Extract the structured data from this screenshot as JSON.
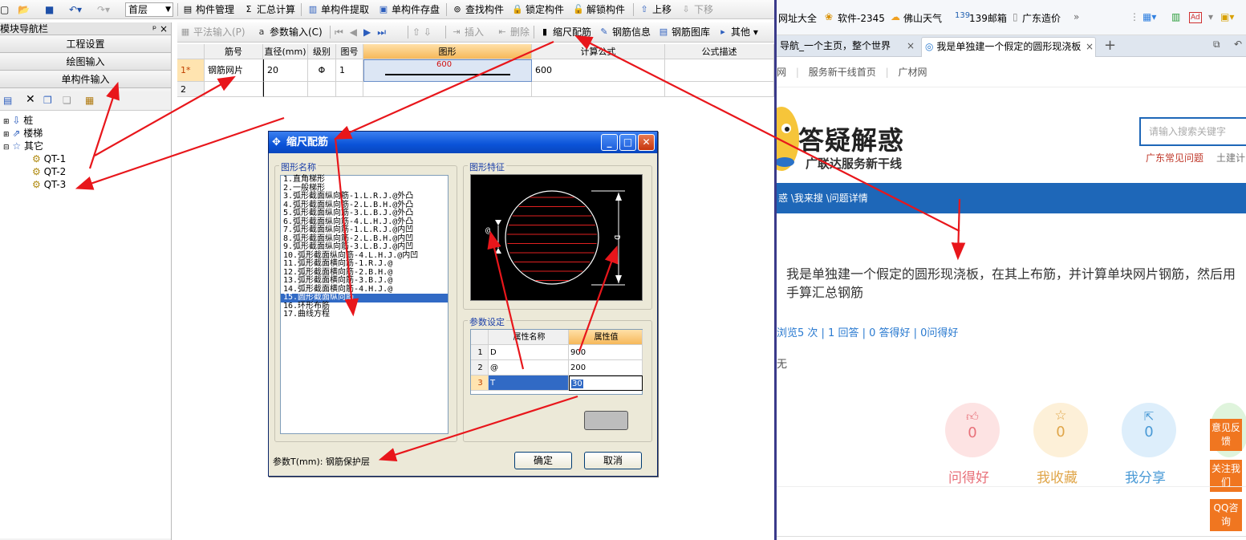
{
  "app": {
    "toolbar1": {
      "floor": "首层",
      "items": [
        "构件管理",
        "汇总计算",
        "单构件提取",
        "单构件存盘",
        "查找构件",
        "锁定构件",
        "解锁构件",
        "上移",
        "下移"
      ]
    },
    "toolbar2": {
      "items": [
        "平法输入(P)",
        "参数输入(C)",
        "插入",
        "删除",
        "缩尺配筋",
        "钢筋信息",
        "钢筋图库",
        "其他"
      ]
    },
    "left_nav": {
      "title": "模块导航栏",
      "pin": "ᵖ ×",
      "buttons": [
        "工程设置",
        "绘图输入",
        "单构件输入"
      ],
      "tree": [
        {
          "label": "桩"
        },
        {
          "label": "楼梯"
        },
        {
          "label": "其它",
          "children": [
            "QT-1",
            "QT-2",
            "QT-3"
          ]
        }
      ]
    },
    "grid": {
      "headers": [
        "筋号",
        "直径(mm)",
        "级别",
        "图号",
        "图形",
        "计算公式",
        "公式描述"
      ],
      "rows": [
        {
          "num": "1*",
          "name": "钢筋网片",
          "diameter": "20",
          "grade": "Φ",
          "fig": "1",
          "shape_value": "600",
          "formula": "600",
          "desc": ""
        },
        {
          "num": "2",
          "name": "",
          "diameter": "",
          "grade": "",
          "fig": "",
          "shape_value": "",
          "formula": "",
          "desc": ""
        }
      ]
    }
  },
  "dialog": {
    "title": "缩尺配筋",
    "list_label": "图形名称",
    "preview_label": "图形特征",
    "params_label": "参数设定",
    "shapes": [
      "1.直角梯形",
      "2.一般梯形",
      "3.弧形截面纵向筋-1.L.R.J.@外凸",
      "4.弧形截面纵向筋-2.L.B.H.@外凸",
      "5.弧形截面纵向筋-3.L.B.J.@外凸",
      "6.弧形截面纵向筋-4.L.H.J.@外凸",
      "7.弧形截面纵向筋-1.L.R.J.@内凹",
      "8.弧形截面纵向筋-2.L.B.H.@内凹",
      "9.弧形截面纵向筋-3.L.B.J.@内凹",
      "10.弧形截面纵向筋-4.L.H.J.@内凹",
      "11.弧形截面横向筋-1.R.J.@",
      "12.弧形截面横向筋-2.B.H.@",
      "13.弧形截面横向筋-3.B.J.@",
      "14.弧形截面横向筋-4.H.J.@",
      "15.圆形截面纵向筋",
      "16.环形布筋",
      "17.曲线方程"
    ],
    "selected_index": 14,
    "param_headers": [
      "属性名称",
      "属性值"
    ],
    "params": [
      {
        "idx": "1",
        "name": "D",
        "value": "900"
      },
      {
        "idx": "2",
        "name": "@",
        "value": "200"
      },
      {
        "idx": "3",
        "name": "T",
        "value": "30"
      }
    ],
    "footer_note": "参数T(mm): 钢筋保护层",
    "ok": "确定",
    "cancel": "取消",
    "preview_labels": {
      "at": "@",
      "d": "D"
    }
  },
  "browser": {
    "bookmarks": [
      "网址大全",
      "软件-2345",
      "佛山天气",
      "139邮箱",
      "广东造价",
      "»"
    ],
    "tabs": [
      "导航_一个主页，整个世界",
      "我是单独建一个假定的圆形现浇板"
    ],
    "subnav": [
      "网",
      "服务新干线首页",
      "广材网"
    ],
    "logo_title": "答疑解惑",
    "logo_sub": "广联达服务新干线",
    "search_placeholder": "请输入搜索关键字",
    "links": [
      "广东常见问题",
      "土建计"
    ],
    "breadcrumb": "惑 \\我来搜 \\问题详情",
    "question": "我是单独建一个假定的圆形现浇板，在其上布筋，并计算单块网片钢筋，然后用手算汇总钢筋",
    "stats": "浏览5 次 | 1 回答 | 0 答得好 | 0问得好",
    "none": "无",
    "actions": [
      {
        "count": "0",
        "label": "问得好",
        "color": "#e8717a"
      },
      {
        "count": "0",
        "label": "我收藏",
        "color": "#e0a64a"
      },
      {
        "count": "0",
        "label": "我分享",
        "color": "#4a9ad6"
      }
    ],
    "side_buttons": [
      "意见反馈",
      "关注我们",
      "QQ咨询"
    ]
  },
  "accent": {
    "arrow": "#e8161b",
    "brand_blue": "#1e67b8",
    "orange": "#f07620"
  }
}
